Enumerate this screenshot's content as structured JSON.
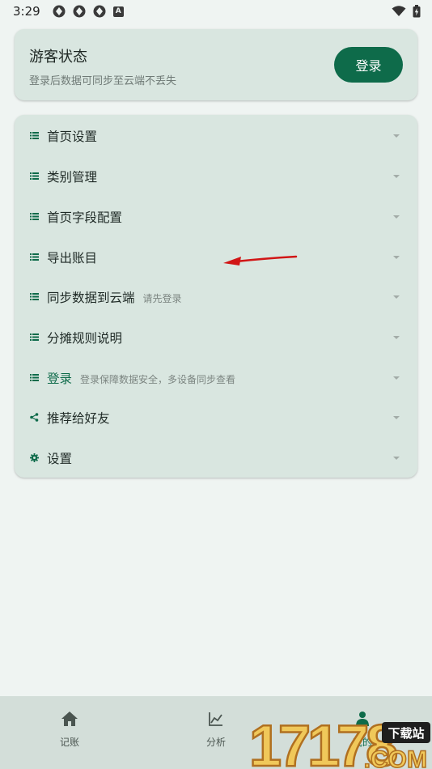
{
  "status_bar": {
    "time": "3:29",
    "letter_icon": "A"
  },
  "guest": {
    "title": "游客状态",
    "subtitle": "登录后数据可同步至云端不丢失",
    "login_button": "登录"
  },
  "menu": {
    "items": [
      {
        "label": "首页设置",
        "icon": "list-icon",
        "extra": ""
      },
      {
        "label": "类别管理",
        "icon": "list-icon",
        "extra": ""
      },
      {
        "label": "首页字段配置",
        "icon": "list-icon",
        "extra": ""
      },
      {
        "label": "导出账目",
        "icon": "list-icon",
        "extra": ""
      },
      {
        "label": "同步数据到云端",
        "icon": "list-icon",
        "extra": "请先登录"
      },
      {
        "label": "分摊规则说明",
        "icon": "list-icon",
        "extra": ""
      },
      {
        "label": "登录",
        "icon": "list-icon",
        "extra": "登录保障数据安全，多设备同步查看"
      },
      {
        "label": "推荐给好友",
        "icon": "share-icon",
        "extra": ""
      },
      {
        "label": "设置",
        "icon": "gear-icon",
        "extra": ""
      }
    ]
  },
  "nav": {
    "items": [
      {
        "label": "记账",
        "icon": "home-icon"
      },
      {
        "label": "分析",
        "icon": "chart-icon"
      },
      {
        "label": "我的",
        "icon": "profile-icon"
      }
    ]
  },
  "watermark": {
    "number": "17178",
    "badge": "下载站",
    "domain": ".COM"
  },
  "colors": {
    "accent": "#0e6b4a",
    "card": "#d9e6e0",
    "background": "#eff4f2",
    "arrow": "#d11616"
  }
}
